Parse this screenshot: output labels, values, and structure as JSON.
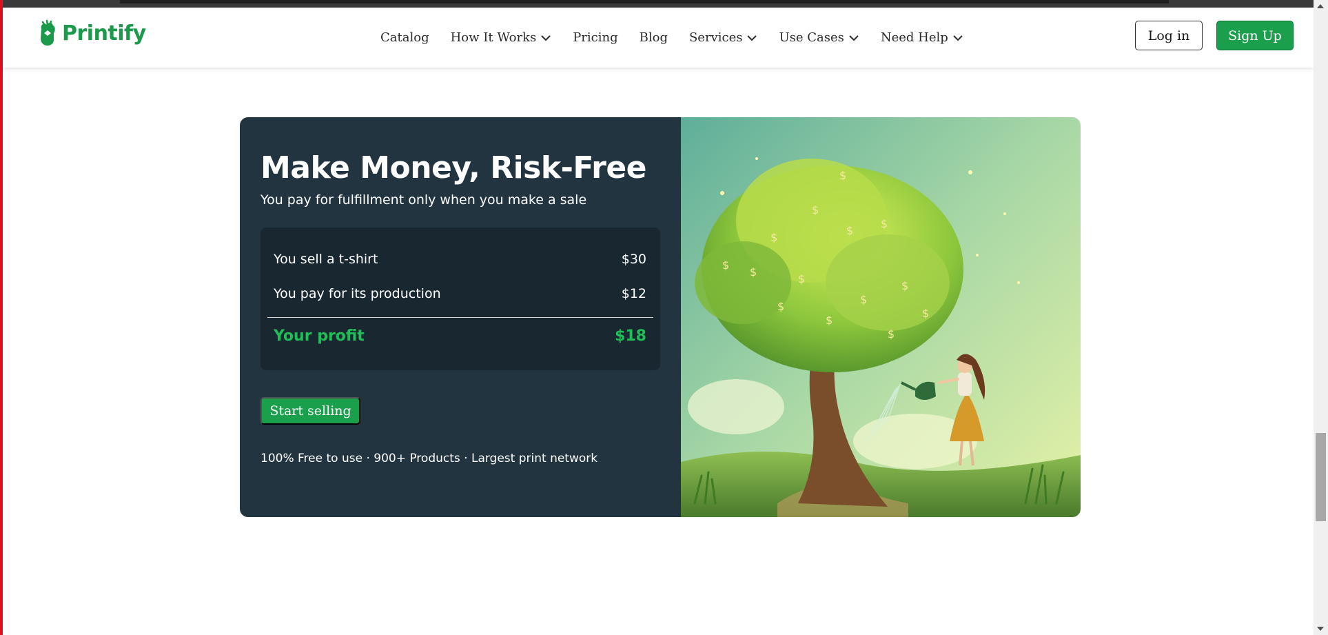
{
  "header": {
    "brand": "Printify",
    "nav": [
      {
        "label": "Catalog",
        "dropdown": false
      },
      {
        "label": "How It Works",
        "dropdown": true
      },
      {
        "label": "Pricing",
        "dropdown": false
      },
      {
        "label": "Blog",
        "dropdown": false
      },
      {
        "label": "Services",
        "dropdown": true
      },
      {
        "label": "Use Cases",
        "dropdown": true
      },
      {
        "label": "Need Help",
        "dropdown": true
      }
    ],
    "login_label": "Log in",
    "signup_label": "Sign Up"
  },
  "hero": {
    "title": "Make Money, Risk-Free",
    "subtitle": "You pay for fulfillment only when you make a sale",
    "calculator": {
      "rows": [
        {
          "label": "You sell a t-shirt",
          "value": "$30"
        },
        {
          "label": "You pay for its production",
          "value": "$12"
        }
      ],
      "total": {
        "label": "Your profit",
        "value": "$18"
      }
    },
    "cta_label": "Start selling",
    "footnote": "100% Free to use · 900+ Products · Largest print network",
    "image_icon": "money-tree-illustration"
  },
  "colors": {
    "brand_green": "#1aa04c",
    "card_bg": "#213440",
    "calc_bg": "#192730",
    "profit_green": "#1fbf58"
  }
}
